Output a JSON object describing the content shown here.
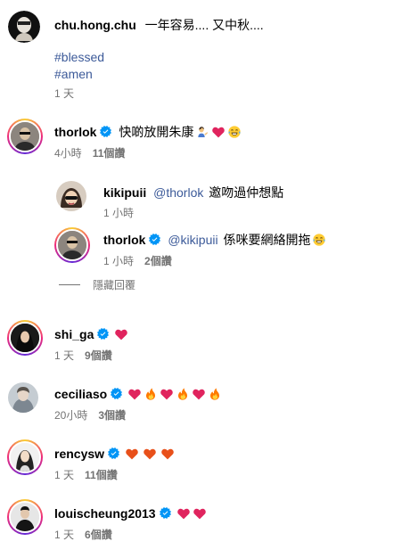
{
  "caption": {
    "username": "chu.hong.chu",
    "text": "一年容易.... 又中秋....",
    "hashtags": [
      "#blessed",
      "#amen"
    ],
    "time": "1 天"
  },
  "comments": [
    {
      "username": "thorlok",
      "text": "快啲放開朱康",
      "emojis": [
        "person-tipping-hand",
        "red-heart",
        "tears-of-joy"
      ],
      "time": "4小時",
      "likes": "11個讚"
    },
    {
      "username": "kikipuii",
      "mention": "@thorlok",
      "text": "邀吻過仲想點",
      "time": "1 小時"
    },
    {
      "username": "thorlok",
      "mention": "@kikipuii",
      "text": "係咪要網絡開拖",
      "emojis": [
        "tears-of-joy"
      ],
      "time": "1 小時",
      "likes": "2個讚"
    },
    {
      "username": "shi_ga",
      "emojis": [
        "red-heart"
      ],
      "time": "1 天",
      "likes": "9個讚"
    },
    {
      "username": "ceciliaso",
      "emojis": [
        "red-heart",
        "fire",
        "red-heart",
        "fire",
        "red-heart",
        "fire"
      ],
      "time": "20小時",
      "likes": "3個讚"
    },
    {
      "username": "rencysw",
      "emojis": [
        "orange-heart",
        "orange-heart",
        "orange-heart"
      ],
      "time": "1 天",
      "likes": "11個讚"
    },
    {
      "username": "louischeung2013",
      "emojis": [
        "red-heart",
        "red-heart"
      ],
      "time": "1 天",
      "likes": "6個讚"
    }
  ],
  "replies": {
    "hide_label": "隱藏回覆"
  },
  "colors": {
    "link": "#3c5a99",
    "meta": "#737373",
    "verified": "#0095f6",
    "heart_red": "#e0245e",
    "heart_orange": "#e8501a",
    "fire": "#ff7a00"
  }
}
